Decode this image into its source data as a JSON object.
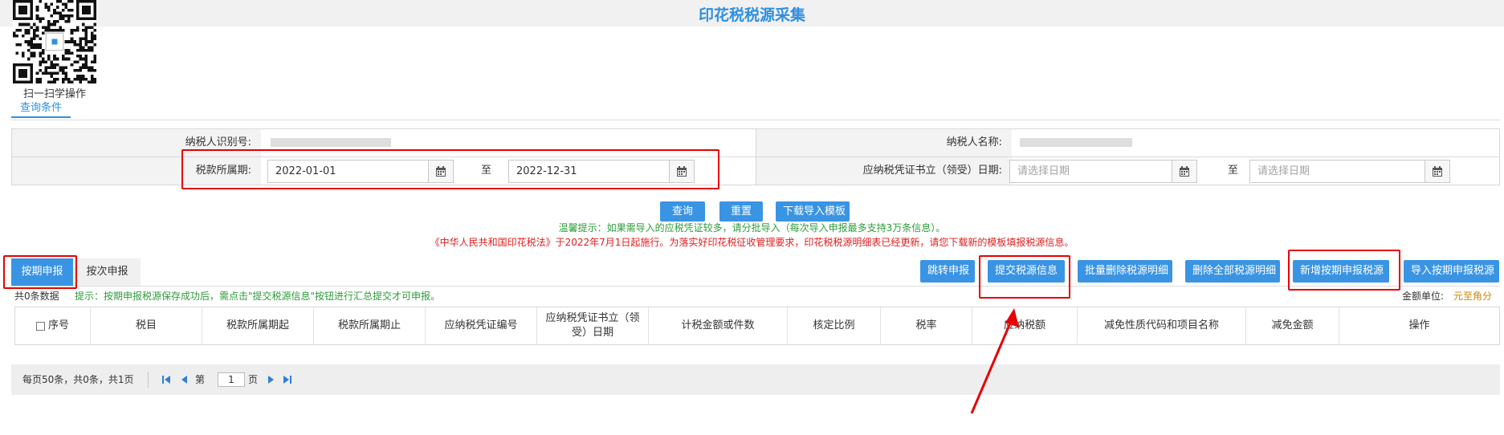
{
  "header": {
    "title": "印花税税源采集",
    "qr_caption": "扫一扫学操作"
  },
  "query": {
    "tab_label": "查询条件",
    "taxpayer_id_label": "纳税人识别号:",
    "taxpayer_name_label": "纳税人名称:",
    "period_label": "税款所属期:",
    "period_start": "2022-01-01",
    "period_end": "2022-12-31",
    "to_label": "至",
    "voucher_date_label": "应纳税凭证书立（领受）日期:",
    "date_placeholder": "请选择日期"
  },
  "actions": {
    "query": "查询",
    "reset": "重置",
    "download_template": "下载导入模板"
  },
  "tips": {
    "warm_tip": "温馨提示：如果需导入的应税凭证较多，请分批导入（每次导入申报最多支持3万条信息）。",
    "law_notice": "《中华人民共和国印花税法》于2022年7月1日起施行。为落实好印花税征收管理要求，印花税税源明细表已经更新，请您下载新的模板填报税源信息。"
  },
  "tabs": {
    "periodic": "按期申报",
    "per_time": "按次申报"
  },
  "toolbar": {
    "jump_declare": "跳转申报",
    "submit_source": "提交税源信息",
    "batch_delete": "批量删除税源明细",
    "delete_all": "删除全部税源明细",
    "add_periodic": "新增按期申报税源",
    "import_periodic": "导入按期申报税源"
  },
  "list": {
    "count_text": "共0条数据",
    "hint": "提示：按期申报税源保存成功后，需点击\"提交税源信息\"按钮进行汇总提交才可申报。",
    "unit_label": "金额单位:",
    "unit_value": "元至角分",
    "columns": [
      "序号",
      "税目",
      "税款所属期起",
      "税款所属期止",
      "应纳税凭证编号",
      "应纳税凭证书立（领受）日期",
      "计税金额或件数",
      "核定比例",
      "税率",
      "应纳税额",
      "减免性质代码和项目名称",
      "减免金额",
      "操作"
    ]
  },
  "pager": {
    "summary": "每页50条，共0条，共1页",
    "page_prefix": "第",
    "page_value": "1",
    "page_suffix": "页"
  },
  "colors": {
    "accent": "#3a94e4",
    "title": "#2f8fe0",
    "annotation": "#e60000",
    "tip_green": "#2e9b3a"
  }
}
